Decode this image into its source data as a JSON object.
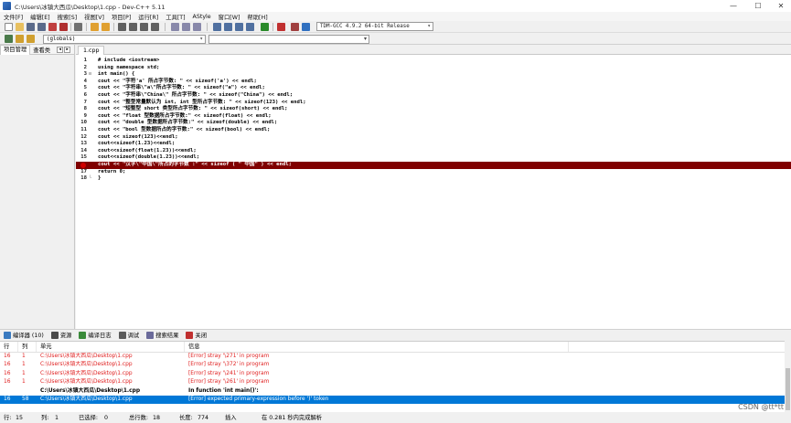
{
  "window": {
    "title": "C:\\Users\\冰镇大西瓜\\Desktop\\1.cpp - Dev-C++ 5.11",
    "minimize": "—",
    "maximize": "☐",
    "close": "✕"
  },
  "menu": [
    "文件[F]",
    "编辑[E]",
    "搜索[S]",
    "视图[V]",
    "项目[P]",
    "运行[R]",
    "工具[T]",
    "AStyle",
    "窗口[W]",
    "帮助[H]"
  ],
  "toolbar": {
    "compiler": "TDM-GCC 4.9.2 64-bit Release",
    "globals": "(globals)"
  },
  "left_panel": {
    "tabs": [
      "项目管理",
      "查看类"
    ],
    "arrow_left": "◂",
    "arrow_right": "▸"
  },
  "editor": {
    "file_tab": "1.cpp",
    "lines": [
      {
        "n": "1",
        "text": "# include <iostream>"
      },
      {
        "n": "2",
        "text": "using namespace std;"
      },
      {
        "n": "3",
        "text": "int main() {"
      },
      {
        "n": "4",
        "text": "cout << \"字符'a' 所占字节数: \" << sizeof('a') << endl;"
      },
      {
        "n": "5",
        "text": "cout << \"字符串\\\"a\\\"所占字节数: \" << sizeof(\"a\") << endl;"
      },
      {
        "n": "6",
        "text": "cout << \"字符串\\\"China\\\" 所占字节数: \" << sizeof(\"China\") << endl;"
      },
      {
        "n": "7",
        "text": "cout << \"整型常量默认为 int, int 型所占字节数: \" << sizeof(123) << endl;"
      },
      {
        "n": "8",
        "text": "cout << \"短整型 short 类型所占字节数: \" << sizeof(short) << endl;"
      },
      {
        "n": "9",
        "text": "cout << \"float 型数据所占字节数:\" << sizeof(float) << endl;"
      },
      {
        "n": "10",
        "text": "cout << \"double 型数据所占字节数:\" << sizeof(double) << endl;"
      },
      {
        "n": "11",
        "text": "cout << \"bool 型数据所占的字节数:\" << sizeof(bool) << endl;"
      },
      {
        "n": "12",
        "text": "cout << sizeof(123)<<endl;"
      },
      {
        "n": "13",
        "text": "cout<<sizeof(1.23)<<endl;"
      },
      {
        "n": "14",
        "text": "cout<<sizeof(float(1.23))<<endl;"
      },
      {
        "n": "15",
        "text": "cout<<sizeof(double(1.23))<<endl;"
      },
      {
        "n": "16",
        "text": "cout << \"汉字\\\"中国\\\"所占的字节数 :\" << sizeof ( \" 中国\" ) << endl;"
      },
      {
        "n": "17",
        "text": "return 0;"
      },
      {
        "n": "18",
        "text": "}"
      }
    ],
    "error_line": "16"
  },
  "bottom_tabs": [
    "编译器 (10)",
    "资源",
    "编译日志",
    "调试",
    "搜索结果",
    "关闭"
  ],
  "messages": {
    "headers": [
      "行",
      "列",
      "单元",
      "信息"
    ],
    "rows": [
      {
        "line": "16",
        "col": "1",
        "unit": "C:\\Users\\冰镇大西瓜\\Desktop\\1.cpp",
        "msg": "[Error] stray '\\271' in program",
        "style": "red"
      },
      {
        "line": "16",
        "col": "1",
        "unit": "C:\\Users\\冰镇大西瓜\\Desktop\\1.cpp",
        "msg": "[Error] stray '\\372' in program",
        "style": "red"
      },
      {
        "line": "16",
        "col": "1",
        "unit": "C:\\Users\\冰镇大西瓜\\Desktop\\1.cpp",
        "msg": "[Error] stray '\\241' in program",
        "style": "red"
      },
      {
        "line": "16",
        "col": "1",
        "unit": "C:\\Users\\冰镇大西瓜\\Desktop\\1.cpp",
        "msg": "[Error] stray '\\261' in program",
        "style": "red"
      },
      {
        "line": "",
        "col": "",
        "unit": "C:\\Users\\冰镇大西瓜\\Desktop\\1.cpp",
        "msg": "In function 'int main()':",
        "style": "bold"
      },
      {
        "line": "16",
        "col": "58",
        "unit": "C:\\Users\\冰镇大西瓜\\Desktop\\1.cpp",
        "msg": "[Error] expected primary-expression before ')' token",
        "style": "sel"
      }
    ]
  },
  "status": {
    "line_label": "行:",
    "line": "15",
    "col_label": "列:",
    "col": "1",
    "selected_label": "已选择:",
    "selected": "0",
    "total_label": "总行数:",
    "total": "18",
    "length_label": "长度:",
    "length": "774",
    "mode": "插入",
    "parse": "在 0.281 秒内完成解析"
  },
  "watermark": "CSDN @tt*tt"
}
